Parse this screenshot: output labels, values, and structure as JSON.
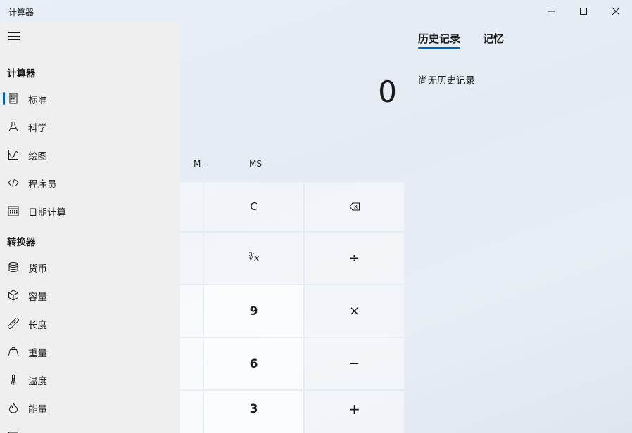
{
  "window": {
    "title": "计算器",
    "controls": {
      "minimize": "minimize-icon",
      "maximize": "maximize-icon",
      "close": "close-icon"
    }
  },
  "nav": {
    "menu_icon": "hamburger-icon",
    "sections": [
      {
        "header": "计算器",
        "items": [
          {
            "label": "标准",
            "icon": "calculator-icon",
            "selected": true
          },
          {
            "label": "科学",
            "icon": "flask-icon"
          },
          {
            "label": "绘图",
            "icon": "graph-icon"
          },
          {
            "label": "程序员",
            "icon": "code-icon"
          },
          {
            "label": "日期计算",
            "icon": "calendar-icon"
          }
        ]
      },
      {
        "header": "转换器",
        "items": [
          {
            "label": "货币",
            "icon": "coins-icon"
          },
          {
            "label": "容量",
            "icon": "cube-icon"
          },
          {
            "label": "长度",
            "icon": "ruler-icon"
          },
          {
            "label": "重量",
            "icon": "weight-icon"
          },
          {
            "label": "温度",
            "icon": "thermometer-icon"
          },
          {
            "label": "能量",
            "icon": "flame-icon"
          }
        ]
      }
    ]
  },
  "calculator": {
    "display": "0",
    "memory": {
      "mminus": "M-",
      "ms": "MS"
    },
    "keys": {
      "clear": "C",
      "backspace": "backspace-icon",
      "cube_root": "∛x",
      "divide": "÷",
      "nine": "9",
      "multiply": "×",
      "six": "6",
      "minus": "−",
      "three": "3",
      "plus": "+"
    }
  },
  "history": {
    "tabs": [
      "历史记录",
      "记忆"
    ],
    "active_tab": "历史记录",
    "empty_text": "尚无历史记录"
  },
  "colors": {
    "accent": "#0063b1",
    "nav_bg": "#efefef",
    "number_key_bg": "#fbfcfd"
  }
}
